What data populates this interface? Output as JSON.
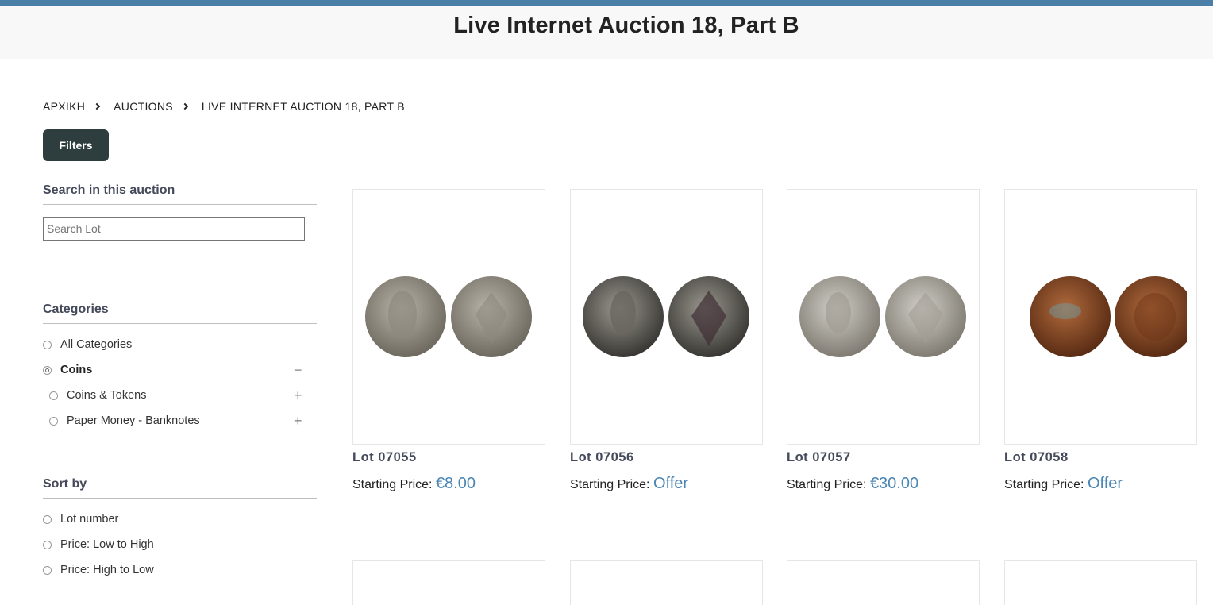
{
  "page": {
    "title": "Live Internet Auction 18, Part B"
  },
  "breadcrumb": [
    "ΑΡΧΙΚΗ",
    "AUCTIONS",
    "LIVE INTERNET AUCTION 18, PART B"
  ],
  "filters_label": "Filters",
  "search": {
    "title": "Search in this auction",
    "placeholder": "Search Lot",
    "value": ""
  },
  "categories": {
    "title": "Categories",
    "items": [
      {
        "label": "All Categories",
        "selected": false,
        "toggle": ""
      },
      {
        "label": "Coins",
        "selected": true,
        "toggle": "−"
      },
      {
        "label": "Coins & Tokens",
        "selected": false,
        "toggle": "+"
      },
      {
        "label": "Paper Money - Banknotes",
        "selected": false,
        "toggle": "+"
      }
    ]
  },
  "sort": {
    "title": "Sort by",
    "options": [
      "Lot number",
      "Price: Low to High",
      "Price: High to Low"
    ]
  },
  "price_prefix": "Starting Price:",
  "lots": [
    {
      "lot": "Lot 07055",
      "price": "€8.00",
      "metal": "silver"
    },
    {
      "lot": "Lot 07056",
      "price": "Offer",
      "metal": "dark-silver"
    },
    {
      "lot": "Lot 07057",
      "price": "€30.00",
      "metal": "silver"
    },
    {
      "lot": "Lot 07058",
      "price": "Offer",
      "metal": "copper"
    }
  ],
  "colors": {
    "accent": "#4a86b4",
    "topbar": "#4a7fa7",
    "button": "#2e3d3d"
  }
}
